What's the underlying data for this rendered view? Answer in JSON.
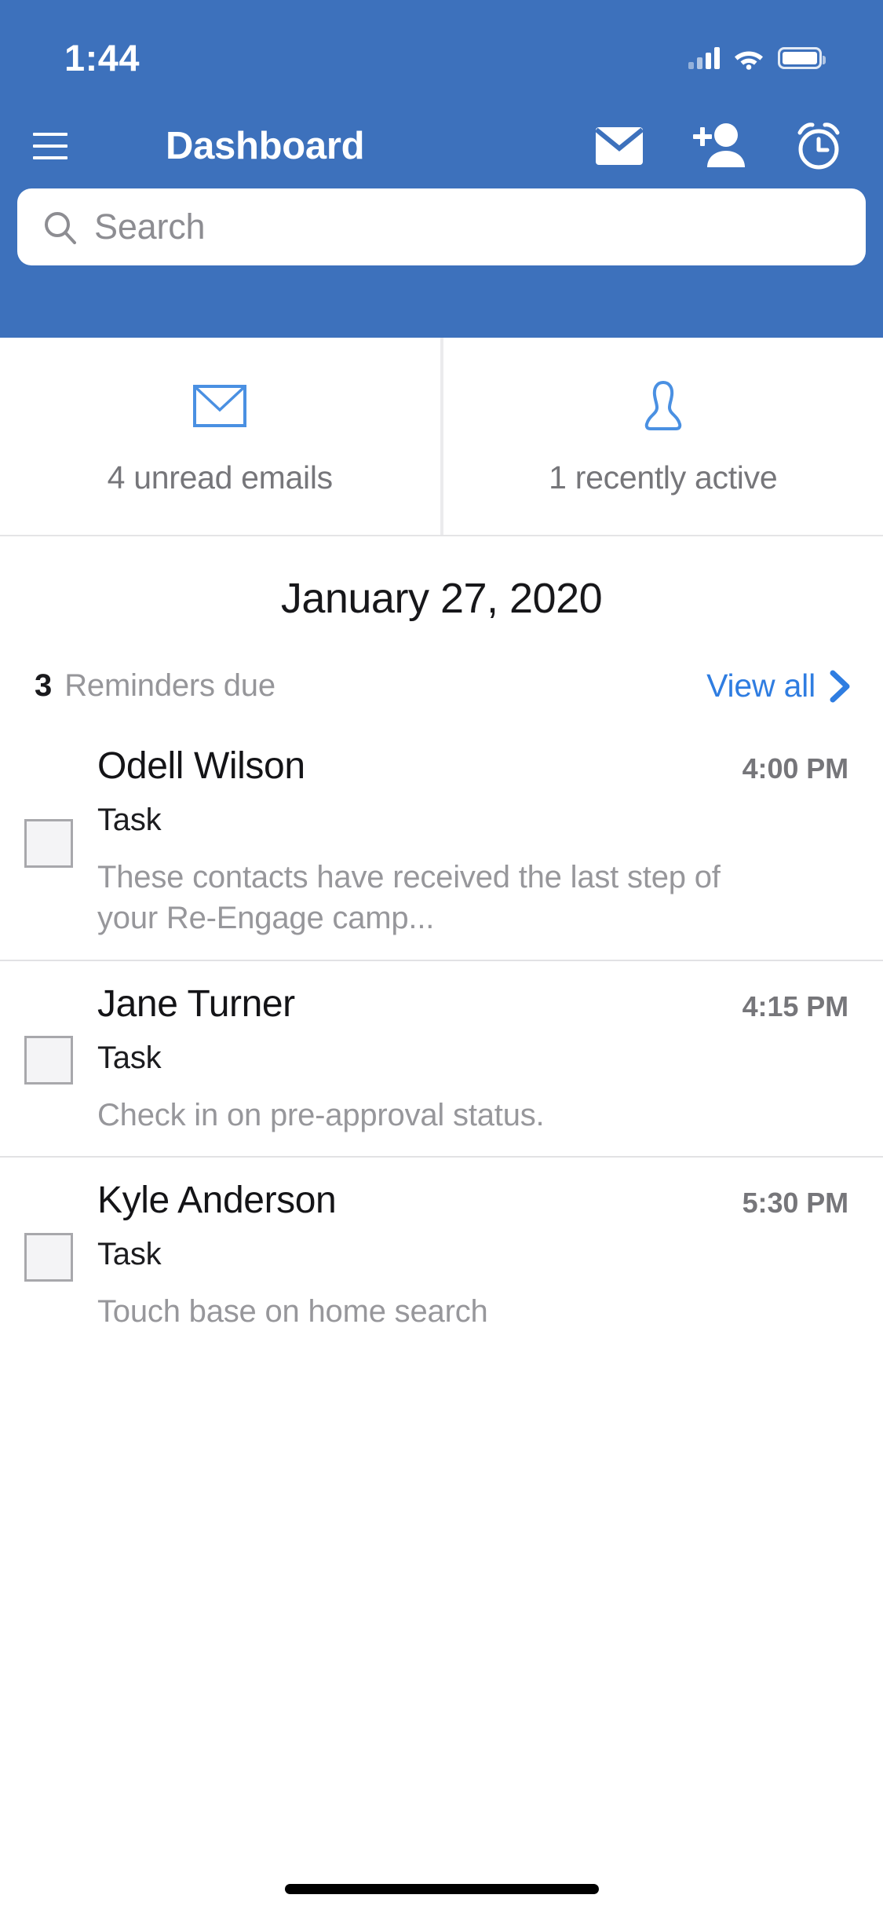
{
  "status_bar": {
    "time": "1:44",
    "signal_icon": "cellular-signal-icon",
    "wifi_icon": "wifi-icon",
    "battery_icon": "battery-icon"
  },
  "nav": {
    "menu_icon": "hamburger-menu-icon",
    "title": "Dashboard",
    "actions": [
      {
        "icon": "envelope-icon",
        "name": "mail-button"
      },
      {
        "icon": "person-add-icon",
        "name": "add-contact-button"
      },
      {
        "icon": "alarm-clock-icon",
        "name": "reminders-button"
      }
    ]
  },
  "search": {
    "placeholder": "Search",
    "value": "",
    "icon": "search-icon"
  },
  "cards": [
    {
      "icon": "envelope-outline-icon",
      "label": "4 unread emails",
      "count": 4
    },
    {
      "icon": "person-outline-icon",
      "label": "1 recently active",
      "count": 1
    }
  ],
  "date_title": "January 27, 2020",
  "reminders_header": {
    "count": "3",
    "label": "Reminders due",
    "view_all": "View all",
    "chevron_icon": "chevron-right-icon"
  },
  "reminders": [
    {
      "name": "Odell Wilson",
      "time": "4:00 PM",
      "type": "Task",
      "description": "These contacts have received the last step of your Re-Engage camp...",
      "checked": false
    },
    {
      "name": "Jane Turner",
      "time": "4:15 PM",
      "type": "Task",
      "description": "Check in on pre-approval status.",
      "checked": false
    },
    {
      "name": "Kyle Anderson",
      "time": "5:30 PM",
      "type": "Task",
      "description": "Touch base on home search",
      "checked": false
    }
  ],
  "colors": {
    "header_blue": "#3d71bc",
    "accent_blue": "#2f7de1",
    "card_icon_blue": "#4a90e2",
    "muted_text": "#96969a",
    "primary_text": "#141417"
  },
  "home_indicator": "home-indicator"
}
